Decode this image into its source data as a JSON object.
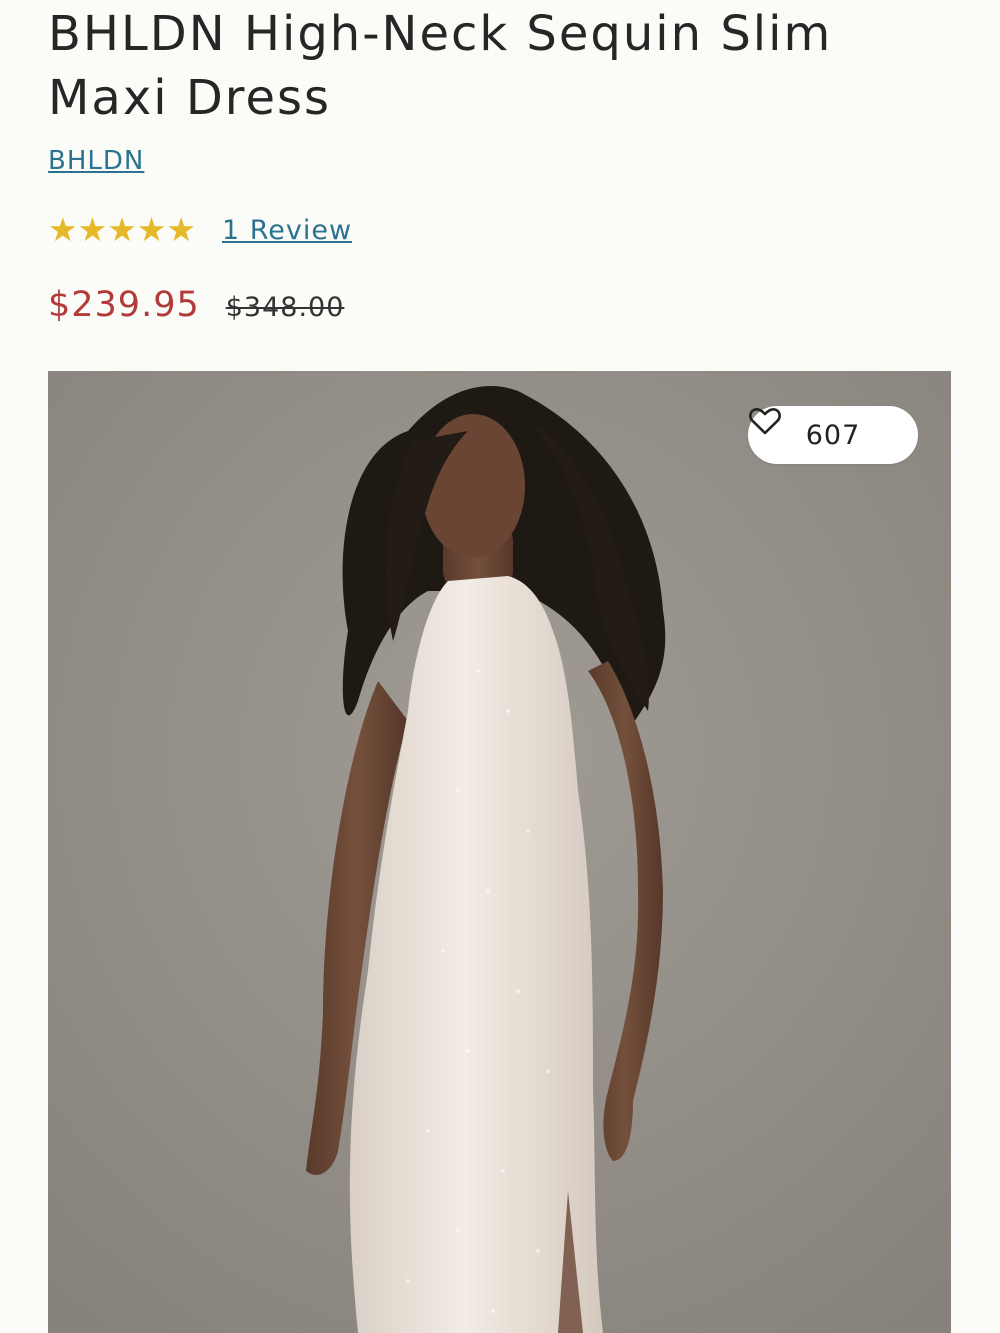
{
  "product": {
    "title": "BHLDN High-Neck Sequin Slim Maxi Dress",
    "brand": "BHLDN",
    "rating": 5,
    "rating_max": 5,
    "review_link": "1 Review",
    "sale_price": "$239.95",
    "original_price": "$348.00"
  },
  "image": {
    "favorites_count": "607",
    "favorite_icon": "heart-outline-icon",
    "star_icon": "star-icon"
  },
  "colors": {
    "link": "#2c7391",
    "sale_price": "#b33a3a",
    "star": "#e6b92b"
  }
}
